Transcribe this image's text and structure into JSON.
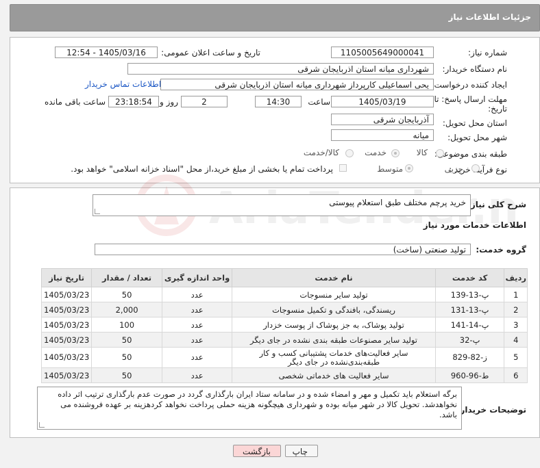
{
  "header": {
    "title": "جزئیات اطلاعات نیاز"
  },
  "form": {
    "need_number_label": "شماره نیاز:",
    "need_number": "1105005649000041",
    "announce_label": "تاریخ و ساعت اعلان عمومی:",
    "announce_value": "1405/03/16 - 12:54",
    "buyer_org_label": "نام دستگاه خریدار:",
    "buyer_org": "شهرداری میانه استان اذربایجان شرقی",
    "creator_label": "ایجاد کننده درخواست:",
    "creator": "یحی اسماعیلی  کارپرداز شهرداری میانه استان اذربایجان شرقی",
    "contact_link": "اطلاعات تماس خریدار",
    "deadline_label_1": "مهلت ارسال پاسخ: تا",
    "deadline_label_2": "تاریخ:",
    "deadline_date": "1405/03/19",
    "time_label": "ساعت",
    "deadline_time": "14:30",
    "days_value": "2",
    "days_label": "روز و",
    "remaining_time": "23:18:54",
    "remaining_label": "ساعت باقی مانده",
    "province_label": "استان محل تحویل:",
    "province": "آذربایجان شرقی",
    "city_label": "شهر محل تحویل:",
    "city": "میانه",
    "category_label": "طبقه بندی موضوعی:",
    "category_options": [
      "کالا",
      "خدمت",
      "کالا/خدمت"
    ],
    "category_selected": "خدمت",
    "process_label": "نوع فرآیند خرید :",
    "process_options": [
      "جزیی",
      "متوسط"
    ],
    "process_selected": "متوسط",
    "payment_note": "پرداخت تمام یا بخشی از مبلغ خرید،از محل \"اسناد خزانه اسلامی\" خواهد بود."
  },
  "summary": {
    "label": "شرح کلی نیاز:",
    "value": "خرید پرچم  مختلف طبق استعلام پیوستی"
  },
  "services": {
    "section_title": "اطلاعات خدمات مورد نیاز",
    "group_label": "گروه خدمت:",
    "group_value": "تولید صنعتی (ساخت)",
    "columns": [
      "ردیف",
      "کد خدمت",
      "نام خدمت",
      "واحد اندازه گیری",
      "تعداد / مقدار",
      "تاریخ نیاز"
    ],
    "rows": [
      [
        "1",
        "پ-13-139",
        "تولید سایر منسوجات",
        "عدد",
        "50",
        "1405/03/23"
      ],
      [
        "2",
        "پ-13-131",
        "ریسندگی، بافندگی و تکمیل منسوجات",
        "عدد",
        "2,000",
        "1405/03/23"
      ],
      [
        "3",
        "پ-14-141",
        "تولید پوشاک، به جز پوشاک از پوست خزدار",
        "عدد",
        "100",
        "1405/03/23"
      ],
      [
        "4",
        "پ-32",
        "تولید سایر مصنوعات طبقه بندی نشده در جای دیگر",
        "عدد",
        "50",
        "1405/03/23"
      ],
      [
        "5",
        "ز-82-829",
        "سایر فعالیت‌های خدمات پشتیبانی کسب و کار طبقه‌بندی‌نشده در جای دیگر",
        "عدد",
        "50",
        "1405/03/23"
      ],
      [
        "6",
        "ط-96-960",
        "سایر فعالیت های خدماتی شخصی",
        "عدد",
        "50",
        "1405/03/23"
      ]
    ]
  },
  "buyer_notes": {
    "label": "توضیحات خریدار:",
    "value": "برگه استعلام باید تکمیل و مهر و امضاء شده و در سامانه ستاد ایران بارگذاری گردد در صورت عدم بارگذاری ترتیب اثر داده نخواهدشد. تحویل کالا در شهر میانه بوده و شهرداری هیچگونه هزینه حملی پرداخت نخواهد کردهزینه بر عهده فروشنده می باشد."
  },
  "buttons": {
    "print": "چاپ",
    "back": "بازگشت"
  },
  "watermark": {
    "text": "AriaTender.neT"
  },
  "colors": {
    "header_bg": "#9a9a9a",
    "link": "#1a56c4",
    "back_btn_bg": "#fbd6d6",
    "table_head": "#e6e6e6"
  }
}
